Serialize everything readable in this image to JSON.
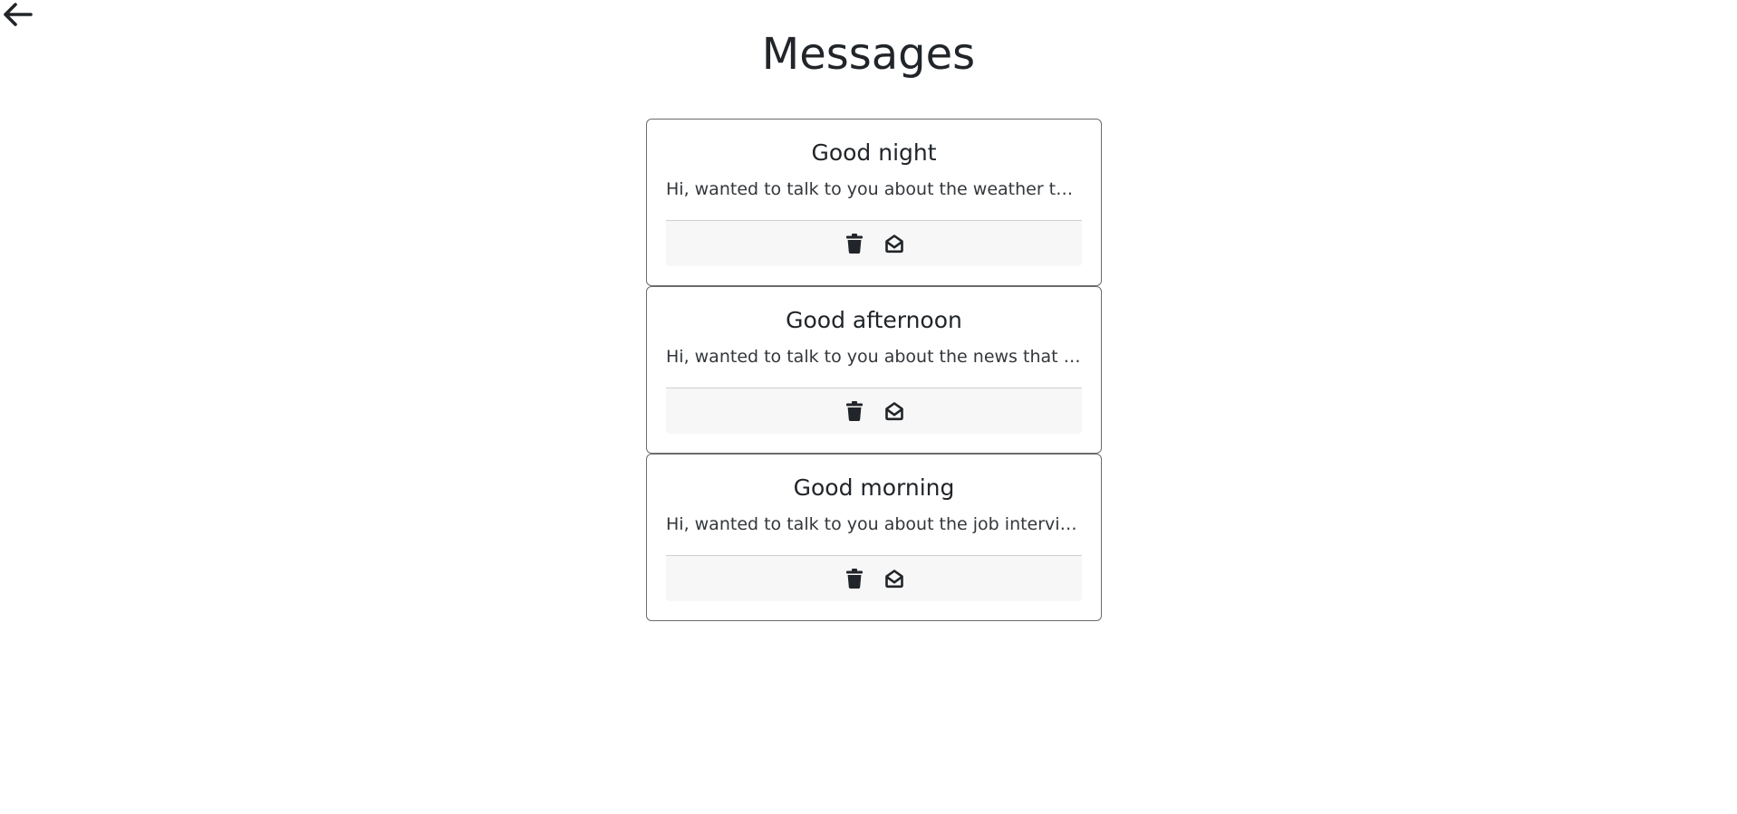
{
  "header": {
    "title": "Messages",
    "back_icon": "arrow-left-icon"
  },
  "messages": [
    {
      "title": "Good night",
      "preview": "Hi, wanted to talk to you about the weather that ...",
      "delete_icon": "trash-icon",
      "read_icon": "envelope-open-icon"
    },
    {
      "title": "Good afternoon",
      "preview": "Hi, wanted to talk to you about the news that was...",
      "delete_icon": "trash-icon",
      "read_icon": "envelope-open-icon"
    },
    {
      "title": "Good morning",
      "preview": "Hi, wanted to talk to you about the job interview y...",
      "delete_icon": "trash-icon",
      "read_icon": "envelope-open-icon"
    }
  ],
  "colors": {
    "text": "#212529",
    "card_border": "#6c6c6c",
    "footer_bg": "#f7f7f7"
  }
}
